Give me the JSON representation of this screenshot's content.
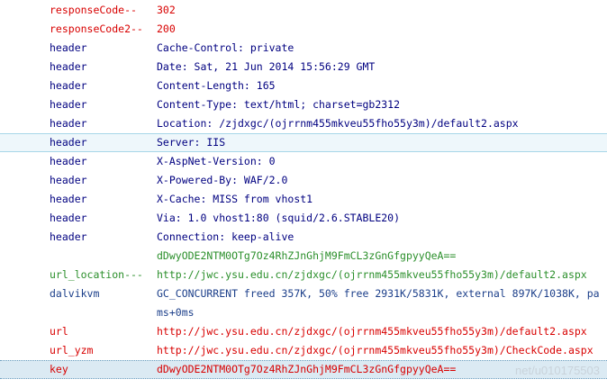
{
  "log_rows": [
    {
      "tag": "responseCode--",
      "message": "302"
    },
    {
      "tag": "responseCode2--",
      "message": "200"
    },
    {
      "tag": "header",
      "message": "Cache-Control: private"
    },
    {
      "tag": "header",
      "message": "Date: Sat, 21 Jun 2014 15:56:29 GMT"
    },
    {
      "tag": "header",
      "message": "Content-Length: 165"
    },
    {
      "tag": "header",
      "message": "Content-Type: text/html; charset=gb2312"
    },
    {
      "tag": "header",
      "message": "Location: /zjdxgc/(ojrrnm455mkveu55fho55y3m)/default2.aspx"
    },
    {
      "tag": "header",
      "message": "Server: IIS"
    },
    {
      "tag": "header",
      "message": "X-AspNet-Version: 0"
    },
    {
      "tag": "header",
      "message": "X-Powered-By: WAF/2.0"
    },
    {
      "tag": "header",
      "message": "X-Cache: MISS from vhost1"
    },
    {
      "tag": "header",
      "message": "Via: 1.0 vhost1:80 (squid/2.6.STABLE20)"
    },
    {
      "tag": "header",
      "message": "Connection: keep-alive"
    },
    {
      "tag": "",
      "message": "dDwyODE2NTM0OTg7Oz4RhZJnGhjM9FmCL3zGnGfgpyyQeA=="
    },
    {
      "tag": "url_location---",
      "message": "http://jwc.ysu.edu.cn/zjdxgc/(ojrrnm455mkveu55fho55y3m)/default2.aspx"
    },
    {
      "tag": "dalvikvm",
      "message": "GC_CONCURRENT freed 357K, 50% free 2931K/5831K, external 897K/1038K, pa"
    },
    {
      "tag": "",
      "message": "ms+0ms"
    },
    {
      "tag": "url",
      "message": "http://jwc.ysu.edu.cn/zjdxgc/(ojrrnm455mkveu55fho55y3m)/default2.aspx"
    },
    {
      "tag": "url_yzm",
      "message": "http://jwc.ysu.edu.cn/zjdxgc/(ojrrnm455mkveu55fho55y3m)/CheckCode.aspx"
    },
    {
      "tag": "key",
      "message": "dDwyODE2NTM0OTg7Oz4RhZJnGhjM9FmCL3zGnGfgpyyQeA=="
    }
  ],
  "watermark": "net/u010175503",
  "colors": {
    "error_red": "#d80000",
    "debug_navy": "#000080",
    "info_green": "#2b8f2b",
    "verbose_blue": "#1c3f8a",
    "highlight_row": "#eef7fb",
    "selected_row": "#dbeaf3"
  }
}
